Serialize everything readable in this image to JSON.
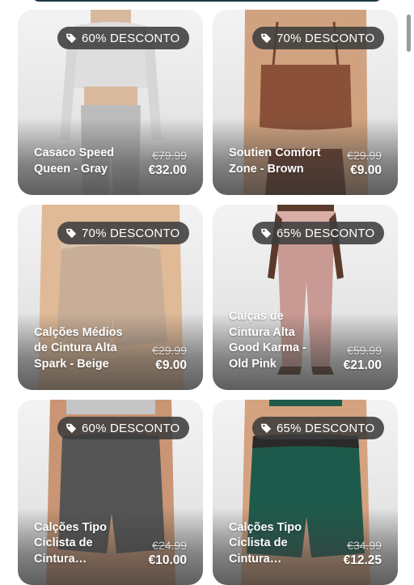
{
  "products": [
    {
      "badge": "60% DESCONTO",
      "title": "Casaco Speed Queen - Gray",
      "old_price": "€79.99",
      "new_price": "€32.00",
      "figure": "model-top-jacket-gray",
      "colors": {
        "top": "#d9d9d9",
        "bottom": "#bdbdbd",
        "skin": "#d9b99e"
      }
    },
    {
      "badge": "70% DESCONTO",
      "title": "Soutien Comfort Zone - Brown",
      "old_price": "€29.99",
      "new_price": "€9.00",
      "figure": "model-bra-brown",
      "colors": {
        "top": "#8a5138",
        "bottom": "#6d3c29",
        "skin": "#d1a27f"
      }
    },
    {
      "badge": "70% DESCONTO",
      "title": "Calções Médios de Cintura Alta Spark - Beige",
      "old_price": "€29.99",
      "new_price": "€9.00",
      "figure": "model-shorts-beige",
      "colors": {
        "top": "#dcc7b6",
        "bottom": "#c7ab94",
        "skin": "#e0b996"
      }
    },
    {
      "badge": "65% DESCONTO",
      "title": "Calças de Cintura Alta Good Karma - Old Pink",
      "old_price": "€59.99",
      "new_price": "€21.00",
      "figure": "model-leggings-pink",
      "colors": {
        "top": "#d4a8a1",
        "bottom": "#c49089",
        "skin": "#5a3b2b"
      }
    },
    {
      "badge": "60% DESCONTO",
      "title": "Calções Tipo Ciclista de Cintura Regular...",
      "old_price": "€24.99",
      "new_price": "€10.00",
      "figure": "model-bike-shorts-charcoal",
      "colors": {
        "top": "#5e5e5e",
        "bottom": "#4d4d4d",
        "skin": "#c99574"
      }
    },
    {
      "badge": "65% DESCONTO",
      "title": "Calções Tipo Ciclista de Cintura Regular...",
      "old_price": "€34.99",
      "new_price": "€12.25",
      "figure": "model-bike-shorts-green",
      "colors": {
        "top": "#1e5a4b",
        "bottom": "#184a3e",
        "skin": "#d5a27f"
      }
    }
  ],
  "badge_icon": "tag-icon"
}
